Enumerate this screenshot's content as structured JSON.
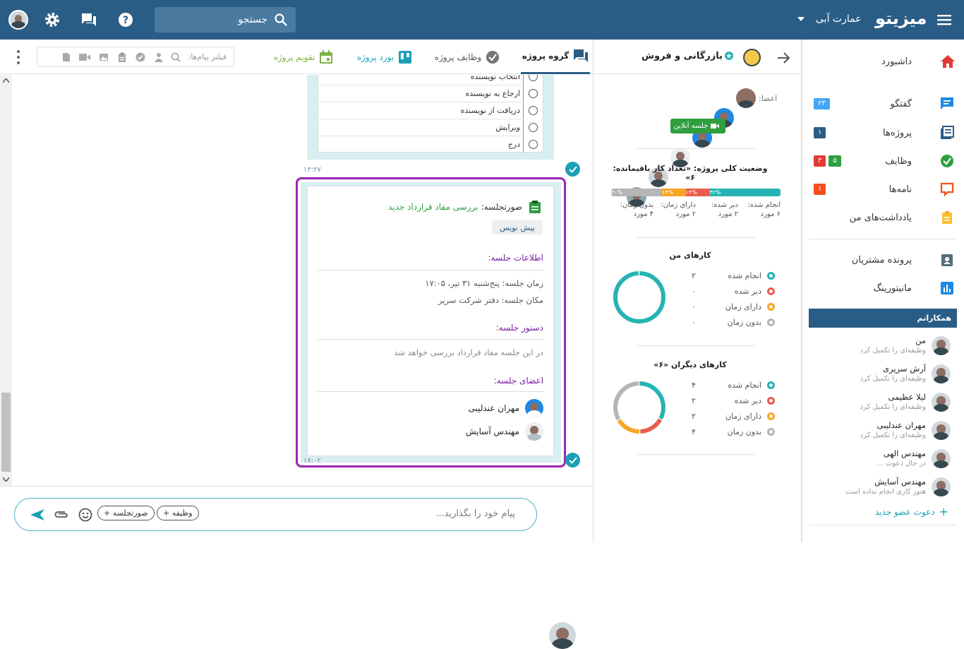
{
  "topbar": {
    "brand": "میزیتو",
    "workspace": "عمارت آبی",
    "search_placeholder": "جستجو"
  },
  "sidebar": {
    "items": [
      {
        "label": "داشبورد"
      },
      {
        "label": "گفتگو",
        "badge": "۲۳"
      },
      {
        "label": "پروژه‌ها",
        "badge": "۱"
      },
      {
        "label": "وظایف",
        "badge_green": "۵",
        "badge_red": "۳"
      },
      {
        "label": "نامه‌ها",
        "badge": "۱"
      },
      {
        "label": "یادداشت‌های من"
      },
      {
        "label": "پرونده مشتریان"
      },
      {
        "label": "مانیتورینگ"
      }
    ],
    "colleagues_title": "همکارانم",
    "colleagues": [
      {
        "name": "من",
        "status": "وظیفه‌ای را تکمیل کرد"
      },
      {
        "name": "آرش سریری",
        "status": "وظیفه‌ای را تکمیل کرد"
      },
      {
        "name": "لیلا عظیمی",
        "status": "وظیفه‌ای را تکمیل کرد"
      },
      {
        "name": "مهران عندلیبی",
        "status": "وظیفه‌ای را تکمیل کرد"
      },
      {
        "name": "مهندس الهی",
        "status": "در حال دعوت ..."
      },
      {
        "name": "مهندس آسایش",
        "status": "هنوز کاری انجام نداده است"
      }
    ],
    "invite": "دعوت عضو جدید"
  },
  "project": {
    "title": "بازرگانی و فروش",
    "members_label": "اعضا:",
    "online_meeting": "جلسه آنلاین",
    "status_title": "وضعیت کلی پروژه: «تعداد کار باقیمانده: ۶»",
    "bar": [
      {
        "pct": "۴۲%",
        "color": "#26b3b3",
        "label": "انجام شده:",
        "count": "۶ مورد",
        "fraction": 0.42
      },
      {
        "pct": "۱۴%",
        "color": "#ea5c4e",
        "label": "دیر شده:",
        "count": "۲ مورد",
        "fraction": 0.14
      },
      {
        "pct": "۱۴%",
        "color": "#f5a623",
        "label": "دارای زمان:",
        "count": "۲ مورد",
        "fraction": 0.14
      },
      {
        "pct": "۳۰%",
        "color": "#b5b5b5",
        "label": "بدون زمان:",
        "count": "۴ مورد",
        "fraction": 0.3
      }
    ],
    "my_tasks_title": "کارهای من",
    "my_tasks": [
      {
        "label": "انجام شده",
        "value": "۲",
        "color": "#26b3b3",
        "n": 2
      },
      {
        "label": "دیر شده",
        "value": "۰",
        "color": "#ea5c4e",
        "n": 0
      },
      {
        "label": "دارای زمان",
        "value": "۰",
        "color": "#f5a623",
        "n": 0
      },
      {
        "label": "بدون زمان",
        "value": "۰",
        "color": "#b5b5b5",
        "n": 0
      }
    ],
    "others_title": "کارهای دیگران «۶»",
    "others_tasks": [
      {
        "label": "انجام شده",
        "value": "۴",
        "color": "#26b3b3",
        "n": 4
      },
      {
        "label": "دیر شده",
        "value": "۲",
        "color": "#ea5c4e",
        "n": 2
      },
      {
        "label": "دارای زمان",
        "value": "۲",
        "color": "#f5a623",
        "n": 2
      },
      {
        "label": "بدون زمان",
        "value": "۴",
        "color": "#b5b5b5",
        "n": 4
      }
    ]
  },
  "tabs": [
    {
      "label": "گروه پروژه"
    },
    {
      "label": "وظایف پروژه"
    },
    {
      "label": "بورد پروژه"
    },
    {
      "label": "تقویم پروژه"
    }
  ],
  "filter_placeholder": "فیلتر پیام‌ها:",
  "checklist": [
    {
      "label": "انتخاب نویسنده"
    },
    {
      "label": "ارجاع به نویسنده"
    },
    {
      "label": "دریافت از نویسنده"
    },
    {
      "label": "ویرایش"
    },
    {
      "label": "درج"
    }
  ],
  "msg1_time": "۱۳:۲۷",
  "minutes": {
    "label": "صورتجلسه:",
    "title": "بررسی مفاد قرارداد جدید",
    "draft": "پیش نویس",
    "info_heading": "اطلاعات جلسه:",
    "time_line": "زمان جلسه: پنج‌شنبه ۳۱ تیر،  ۱۷:۰۵",
    "place_line": "مکان جلسه: دفتر شرکت سریر",
    "agenda_heading": "دستور جلسه:",
    "agenda_text": "در این جلسه مفاد قرارداد بررسی خواهد شد",
    "members_heading": "اعضای جلسه:",
    "members": [
      {
        "name": "مهران عندلیبی"
      },
      {
        "name": "مهندس آسایش"
      }
    ],
    "time": "۱۷:۰۲"
  },
  "composer": {
    "placeholder": "پیام خود را بگذارید...",
    "task_chip": "+ وظیفه",
    "minutes_chip": "+ صورتجلسه"
  }
}
